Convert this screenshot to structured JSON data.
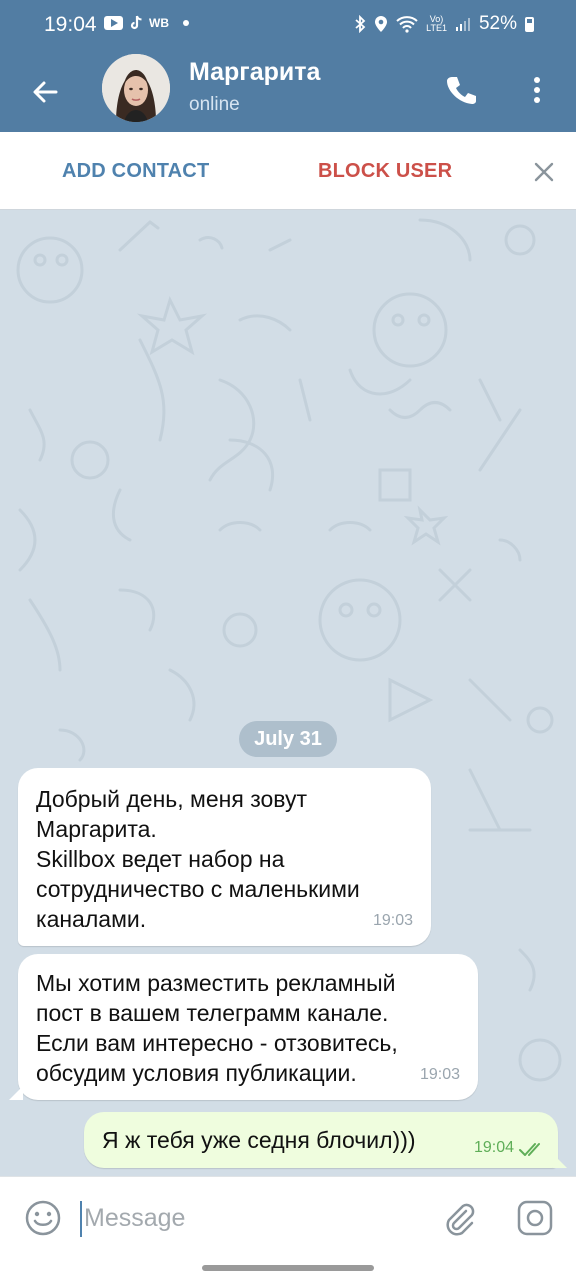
{
  "status_bar": {
    "time": "19:04",
    "left_icons": [
      "youtube-icon",
      "tiktok-icon",
      "wb-icon"
    ],
    "wb_text": "WB",
    "net_top": "Vo)",
    "net_bottom": "LTE1",
    "battery": "52%"
  },
  "header": {
    "contact_name": "Маргарита",
    "status": "online"
  },
  "action_bar": {
    "add_contact": "ADD CONTACT",
    "block_user": "BLOCK USER"
  },
  "chat": {
    "date": "July 31",
    "messages": [
      {
        "direction": "incoming",
        "lines": [
          "Добрый день, меня зовут",
          "Маргарита.",
          "Skillbox ведет набор на",
          "сотрудничество с маленькими",
          "каналами."
        ],
        "time": "19:03"
      },
      {
        "direction": "incoming",
        "lines": [
          "Мы хотим разместить рекламный",
          "пост в вашем телеграмм канале.",
          "Если вам интересно - отзовитесь,",
          "обсудим условия публикации."
        ],
        "time": "19:03"
      },
      {
        "direction": "outgoing",
        "text": "Я ж тебя уже седня блочил)))",
        "time": "19:04",
        "read": true
      }
    ]
  },
  "composer": {
    "placeholder": "Message"
  },
  "colors": {
    "header_bg": "#527da3",
    "add_contact": "#4f82ae",
    "block_user": "#cc5049",
    "chat_bg": "#d2dde6",
    "outgoing_bubble": "#effdde",
    "outgoing_time": "#5fae58"
  }
}
